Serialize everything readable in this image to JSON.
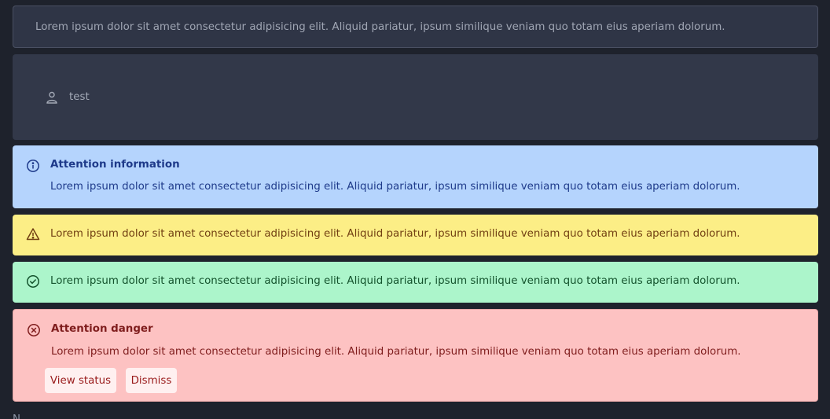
{
  "plain_alert": {
    "message": "Lorem ipsum dolor sit amet consectetur adipisicing elit. Aliquid pariatur, ipsum similique veniam quo totam eius aperiam dolorum."
  },
  "user_box": {
    "icon": "user-icon",
    "label": "test"
  },
  "info_alert": {
    "icon": "info-circle-icon",
    "title": "Attention information",
    "message": "Lorem ipsum dolor sit amet consectetur adipisicing elit. Aliquid pariatur, ipsum similique veniam quo totam eius aperiam dolorum."
  },
  "warning_alert": {
    "icon": "warning-triangle-icon",
    "message": "Lorem ipsum dolor sit amet consectetur adipisicing elit. Aliquid pariatur, ipsum similique veniam quo totam eius aperiam dolorum."
  },
  "success_alert": {
    "icon": "check-circle-icon",
    "message": "Lorem ipsum dolor sit amet consectetur adipisicing elit. Aliquid pariatur, ipsum similique veniam quo totam eius aperiam dolorum."
  },
  "danger_alert": {
    "icon": "x-circle-icon",
    "title": "Attention danger",
    "message": "Lorem ipsum dolor sit amet consectetur adipisicing elit. Aliquid pariatur, ipsum similique veniam quo totam eius aperiam dolorum.",
    "view_status_label": "View status",
    "dismiss_label": "Dismiss"
  },
  "footer": {
    "fragment": "N"
  },
  "colors": {
    "background": "#1e222c",
    "info_bg": "#b5d4fd",
    "warning_bg": "#fcee86",
    "success_bg": "#acf5cb",
    "danger_bg": "#fdc2c2"
  }
}
